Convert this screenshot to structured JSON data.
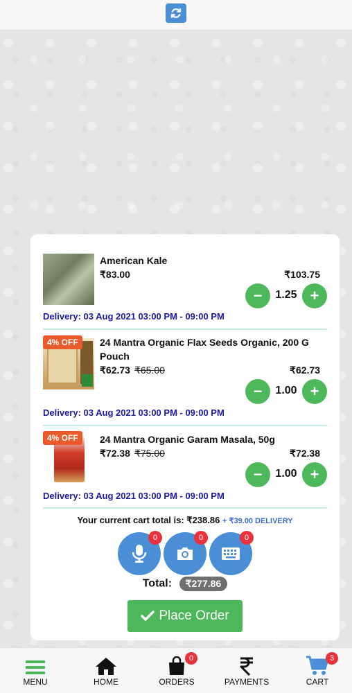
{
  "colors": {
    "accent_blue": "#4a8ed6",
    "green": "#4cb85a",
    "delivery_blue": "#1a1aa8",
    "discount_orange": "#ea5a2b",
    "badge_red": "#e8323c"
  },
  "header": {
    "refresh_icon": "refresh-icon"
  },
  "items": [
    {
      "name": "American Kale",
      "discount": "",
      "price": "₹83.00",
      "old_price": "",
      "line_total": "₹103.75",
      "quantity": "1.25",
      "delivery": "Delivery: 03 Aug 2021 03:00 PM - 09:00 PM"
    },
    {
      "name": "24 Mantra Organic Flax Seeds Organic, 200 G Pouch",
      "discount": "4% OFF",
      "price": "₹62.73",
      "old_price": "₹65.00",
      "line_total": "₹62.73",
      "quantity": "1.00",
      "delivery": "Delivery: 03 Aug 2021 03:00 PM - 09:00 PM"
    },
    {
      "name": "24 Mantra Organic Garam Masala, 50g",
      "discount": "4% OFF",
      "price": "₹72.38",
      "old_price": "₹75.00",
      "line_total": "₹72.38",
      "quantity": "1.00",
      "delivery": "Delivery: 03 Aug 2021 03:00 PM - 09:00 PM"
    }
  ],
  "stepper": {
    "minus": "−",
    "plus": "+"
  },
  "summary": {
    "cart_total_text": "Your current cart total is: ₹238.86",
    "delivery_fee_text": "+ ₹39.00 DELIVERY",
    "total_label": "Total:",
    "total_value": "₹277.86"
  },
  "actions": [
    {
      "icon": "microphone-icon",
      "count": "0"
    },
    {
      "icon": "camera-icon",
      "count": "0"
    },
    {
      "icon": "keyboard-icon",
      "count": "0"
    }
  ],
  "place_order": {
    "label": "Place Order",
    "icon": "check-icon"
  },
  "nav": [
    {
      "label": "MENU",
      "icon": "menu-icon",
      "badge": ""
    },
    {
      "label": "HOME",
      "icon": "home-icon",
      "badge": ""
    },
    {
      "label": "ORDERS",
      "icon": "shopping-bag-icon",
      "badge": "0"
    },
    {
      "label": "PAYMENTS",
      "icon": "rupee-icon",
      "badge": ""
    },
    {
      "label": "CART",
      "icon": "cart-icon",
      "badge": "3"
    }
  ]
}
